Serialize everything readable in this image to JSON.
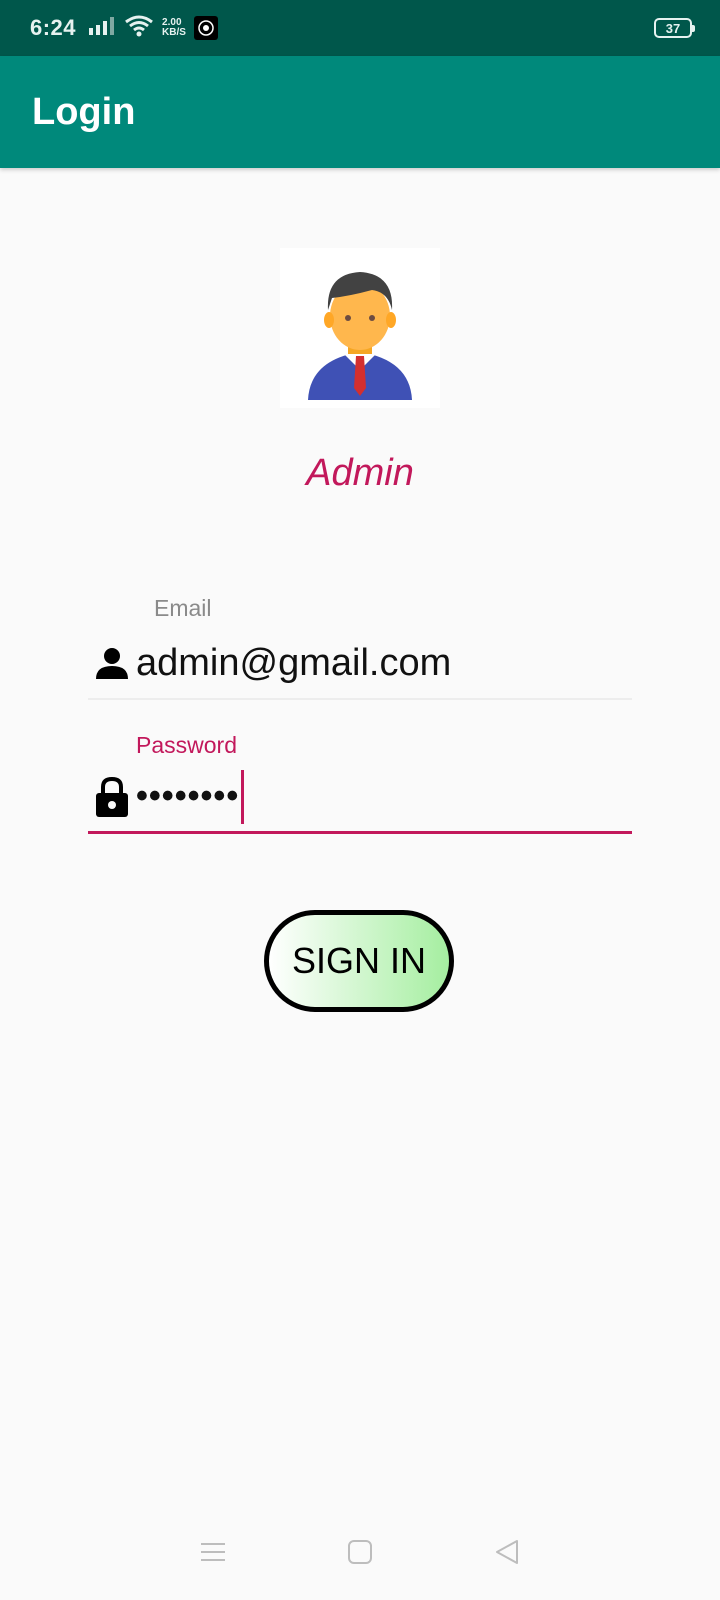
{
  "status_bar": {
    "time": "6:24",
    "net_speed_value": "2.00",
    "net_speed_unit": "KB/S",
    "battery": "37"
  },
  "app_bar": {
    "title": "Login"
  },
  "role": {
    "label": "Admin"
  },
  "email_field": {
    "label": "Email",
    "value": "admin@gmail.com",
    "icon": "person-icon"
  },
  "password_field": {
    "label": "Password",
    "masked_value": "••••••••",
    "icon": "lock-icon"
  },
  "signin_button": {
    "label": "SIGN IN"
  },
  "nav": {
    "icons": [
      "menu-icon",
      "home-icon",
      "back-icon"
    ]
  },
  "colors": {
    "status_bar": "#00574B",
    "app_bar": "#00897B",
    "accent": "#C2185B",
    "button_gradient_end": "#A5EEA0"
  }
}
